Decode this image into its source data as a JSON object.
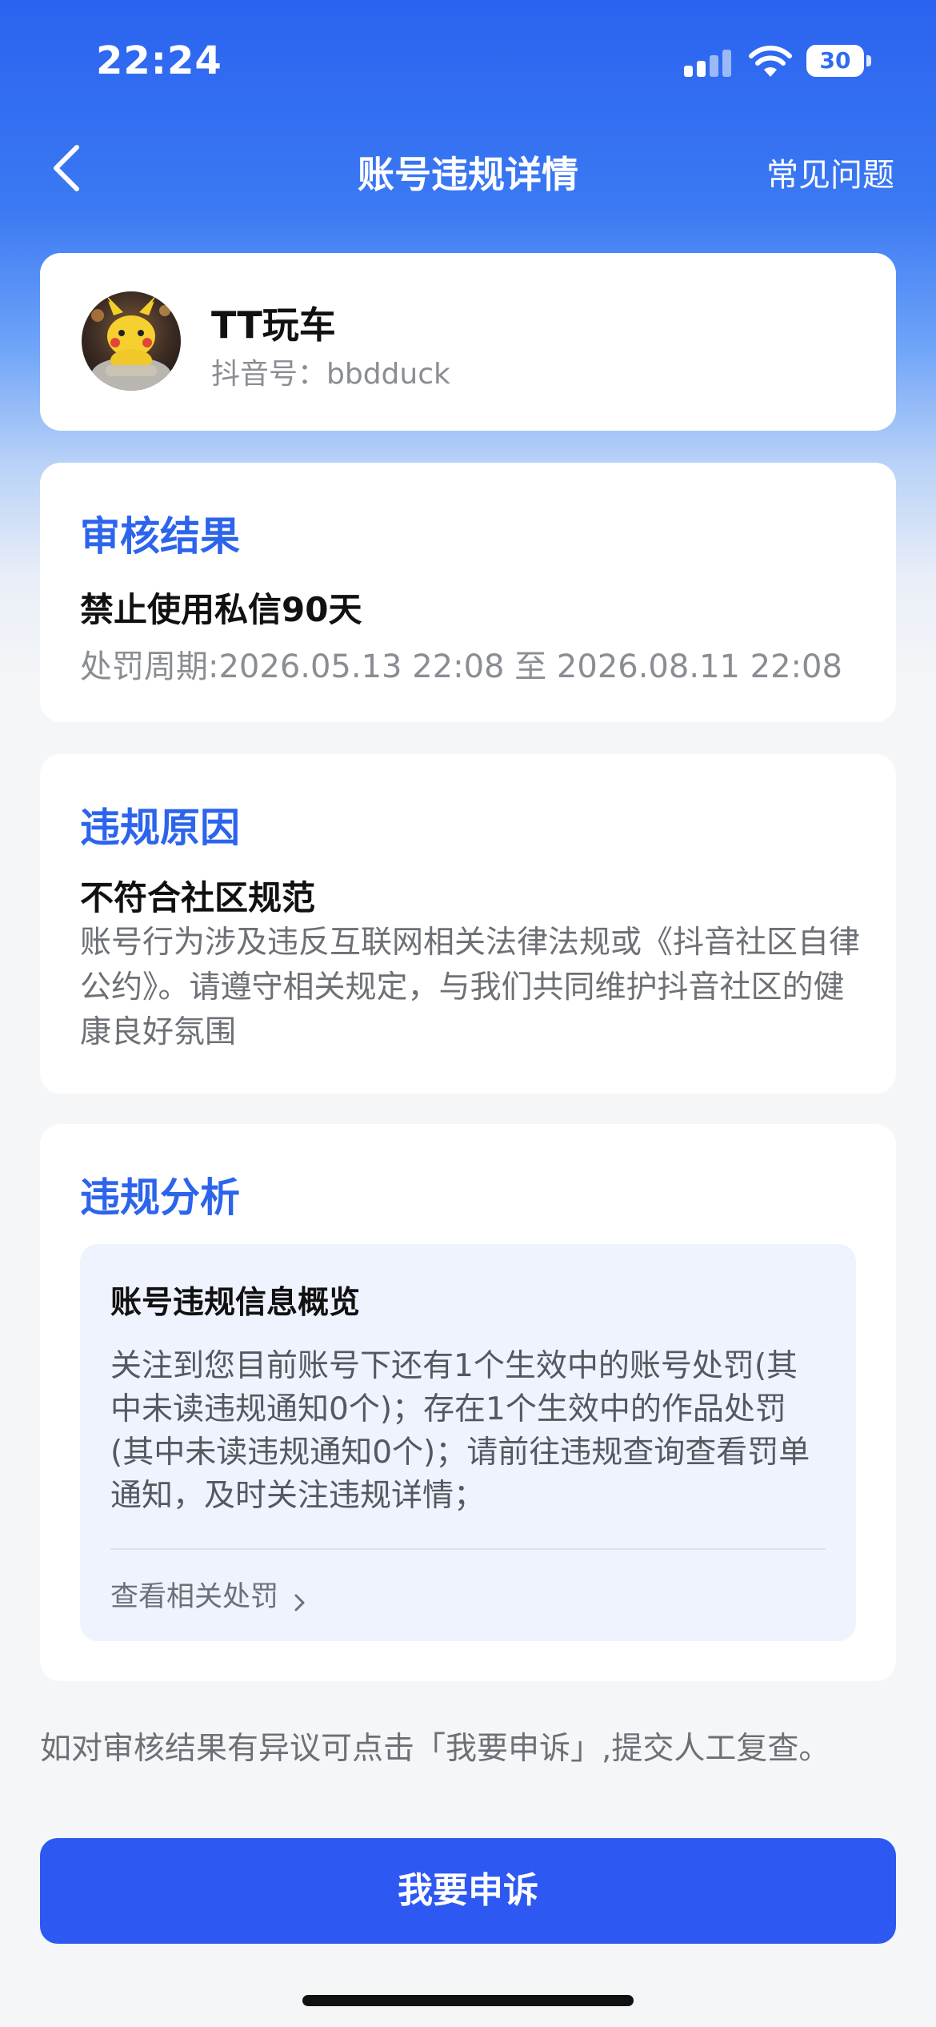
{
  "status_bar": {
    "time": "22:24",
    "battery": "30"
  },
  "nav": {
    "title": "账号违规详情",
    "faq": "常见问题"
  },
  "profile": {
    "name": "TT玩车",
    "id_label": "抖音号：bbdduck"
  },
  "result": {
    "title": "审核结果",
    "main": "禁止使用私信90天",
    "period": "处罚周期:2026.05.13 22:08 至 2026.08.11 22:08"
  },
  "reason": {
    "title": "违规原因",
    "main": "不符合社区规范",
    "desc": "账号行为涉及违反互联网相关法律法规或《抖音社区自律公约》。请遵守相关规定，与我们共同维护抖音社区的健康良好氛围"
  },
  "analysis": {
    "title": "违规分析",
    "box_title": "账号违规信息概览",
    "text": "关注到您目前账号下还有1个生效中的账号处罚(其中未读违规通知0个)；存在1个生效中的作品处罚(其中未读违规通知0个)；请前往违规查询查看罚单通知，及时关注违规详情；",
    "link": "查看相关处罚"
  },
  "appeal": {
    "note": "如对审核结果有异议可点击「我要申诉」,提交人工复查。",
    "button": "我要申诉"
  },
  "colors": {
    "accent": "#2c64ec",
    "button": "#2d59f2",
    "hero": "#2a63f0"
  },
  "icons": [
    "signal-icon",
    "wifi-icon",
    "battery-icon",
    "back-arrow-icon",
    "chevron-right-icon"
  ]
}
